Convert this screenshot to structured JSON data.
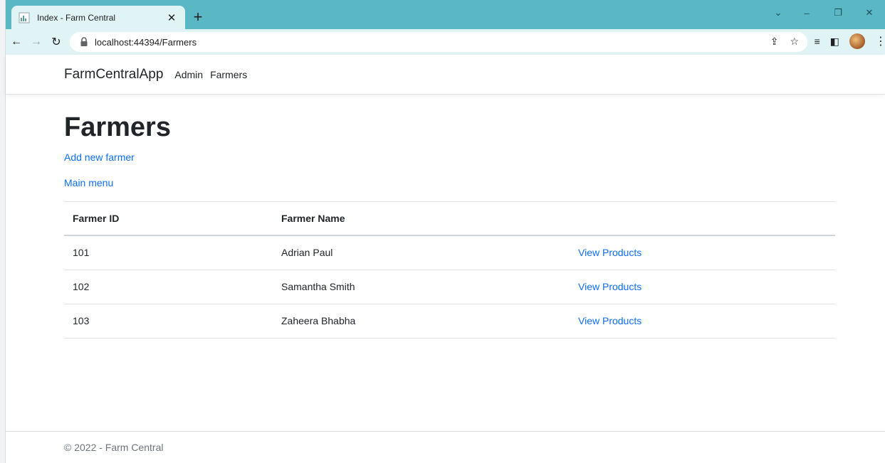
{
  "browser": {
    "tab_title": "Index - Farm Central",
    "tab_close": "✕",
    "new_tab": "+",
    "url": "localhost:44394/Farmers",
    "win_controls": {
      "tabsearch": "⌄",
      "minimize": "–",
      "restore": "❐",
      "close": "✕"
    },
    "nav": {
      "back": "←",
      "forward": "→",
      "reload": "↻"
    },
    "omni_actions": {
      "share": "⇪",
      "bookmark": "☆"
    },
    "extensions": {
      "reading_list": "≡",
      "side_panel": "◧",
      "menu": "⋮"
    },
    "colors": {
      "frame": "#5ab8c4",
      "toolbar": "#e0f3f5"
    }
  },
  "navbar": {
    "brand": "FarmCentralApp",
    "links": [
      "Admin",
      "Farmers"
    ]
  },
  "main": {
    "title": "Farmers",
    "add_link": "Add new farmer",
    "menu_link": "Main menu",
    "table": {
      "headers": [
        "Farmer ID",
        "Farmer Name",
        ""
      ],
      "rows": [
        {
          "id": "101",
          "name": "Adrian Paul",
          "action": "View Products"
        },
        {
          "id": "102",
          "name": "Samantha Smith",
          "action": "View Products"
        },
        {
          "id": "103",
          "name": "Zaheera Bhabha",
          "action": "View Products"
        }
      ]
    },
    "link_color": "#0d6efd"
  },
  "footer": {
    "text": "© 2022 - Farm Central"
  }
}
